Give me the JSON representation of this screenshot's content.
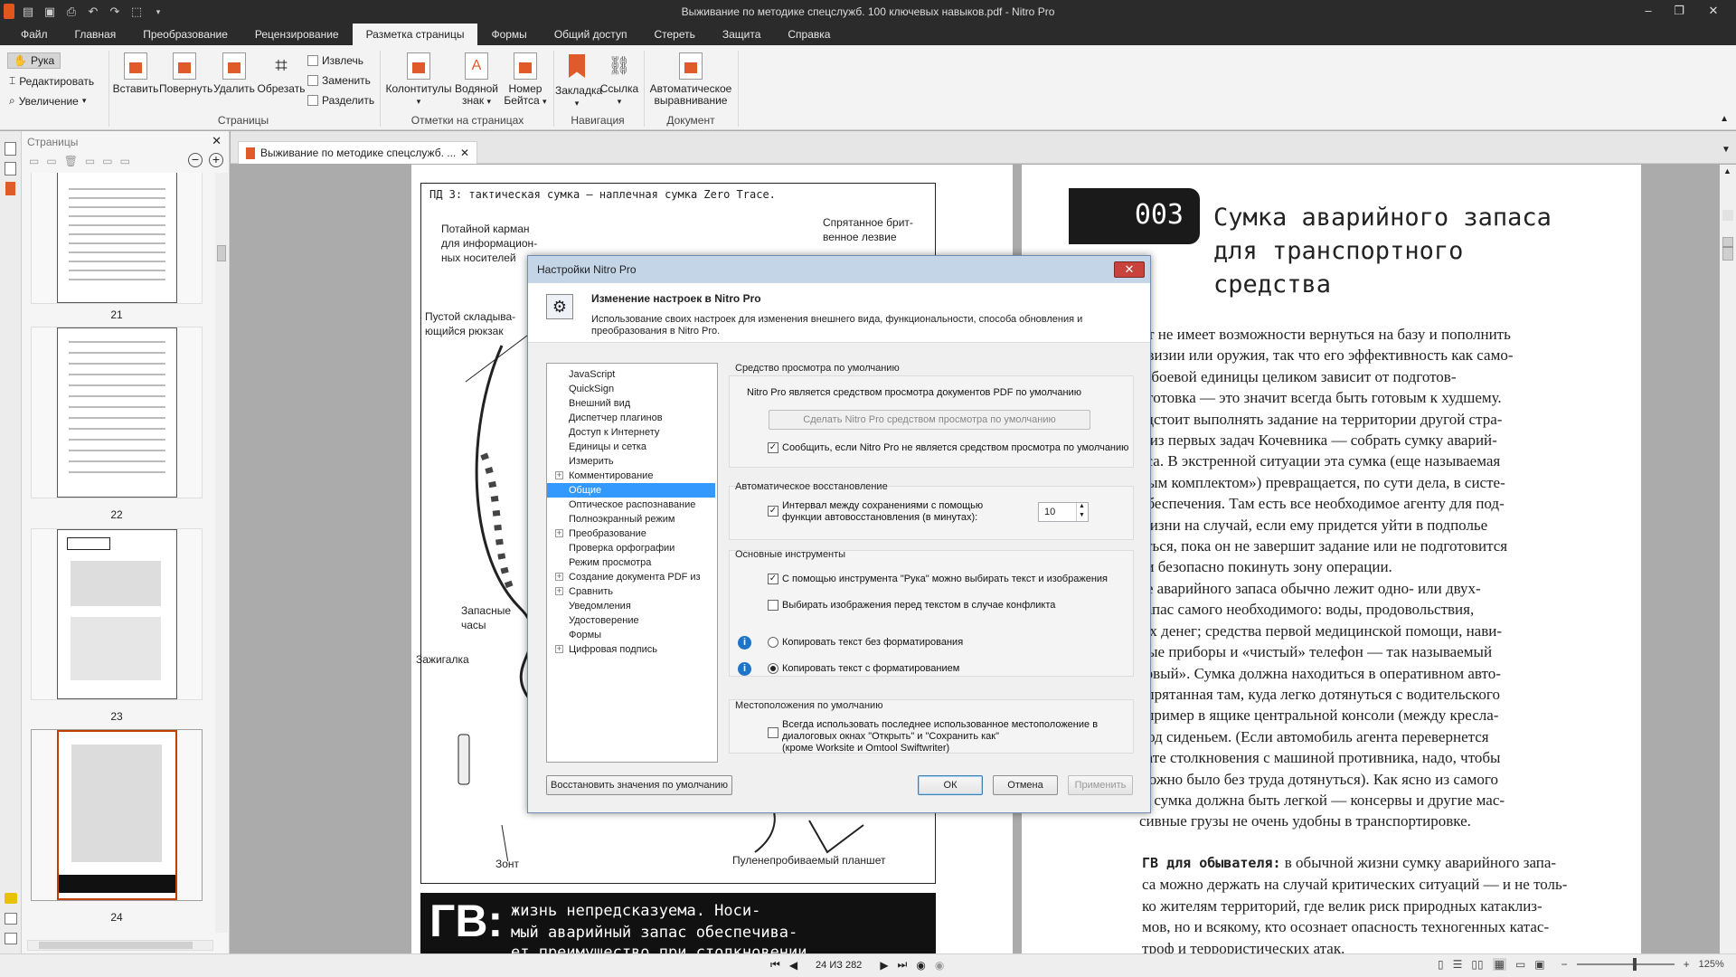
{
  "window": {
    "title": "Выживание по методике спецслужб. 100 ключевых навыков.pdf - Nitro Pro",
    "controls": [
      "–",
      "❐",
      "✕"
    ]
  },
  "menu": {
    "tabs": [
      "Файл",
      "Главная",
      "Преобразование",
      "Рецензирование",
      "Разметка страницы",
      "Формы",
      "Общий доступ",
      "Стереть",
      "Защита",
      "Справка"
    ],
    "active": "Разметка страницы"
  },
  "ribbon": {
    "tools": {
      "hand": "Рука",
      "edit": "Редактировать",
      "zoom": "Увеличение"
    },
    "pages_group": {
      "label": "Страницы",
      "insert": "Вставить",
      "rotate": "Повернуть",
      "delete": "Удалить",
      "crop": "Обрезать",
      "extract": "Извлечь",
      "replace": "Заменить",
      "split": "Разделить"
    },
    "marks_group": {
      "label": "Отметки на страницах",
      "headers": "Колонтитулы",
      "watermark1": "Водяной",
      "watermark2": "знак",
      "bates1": "Номер",
      "bates2": "Бейтса"
    },
    "nav_group": {
      "label": "Навигация",
      "bookmark": "Закладка",
      "link": "Ссылка"
    },
    "doc_group": {
      "label": "Документ",
      "autoalign1": "Автоматическое",
      "autoalign2": "выравнивание"
    }
  },
  "pages_panel": {
    "title": "Страницы",
    "thumbs": [
      "21",
      "22",
      "23",
      "24"
    ]
  },
  "document": {
    "tab_title": "Выживание по методике спецслужб. ...",
    "left_page": {
      "heading": "ПД 3: тактическая сумка — наплечная сумка Zero Trace.",
      "callouts": [
        "Потайной карман для информацион- ных носителей",
        "Спрятанное брит- венное лезвие",
        "Пустой складыва- ющийся рюкзак",
        "Запасные часы",
        "Зажигалка",
        "Зонт",
        "Пуленепробиваемый планшет"
      ],
      "banner_big": "ГВ:",
      "banner_text1": "жизнь непредсказуема. Носи-",
      "banner_text2": "мый аварийный запас обеспечива-",
      "banner_text3": "ет преимущество при столкновении"
    },
    "right_page": {
      "num": "003",
      "title1": "Сумка аварийного запаса",
      "title2": "для транспортного",
      "title3": "средства",
      "lines": [
        "нт не имеет возможности вернуться на базу и пополнить",
        "овизии или оружия, так что его эффективность как само-",
        "й боевой единицы целиком зависит от подготов-",
        "дготовка — это значит всегда быть готовым к худшему.",
        "едстоит выполнять задание на территории другой стра-",
        "а из первых задач Кочевника — собрать сумку аварий-",
        "аса. В экстренной ситуации эта сумка (еще называемая",
        "ным комплектом») превращается, по сути дела, в систе-",
        "обеспечения. Там есть все необходимое агенту для под-",
        "жизни на случай, если ему придется уйти в подполье",
        "аться, пока он не завершит задание или не подготовится",
        "ти безопасно покинуть зону операции.",
        "ке аварийного запаса обычно лежит одно- или двух-",
        "запас самого необходимого: воды, продовольствия,",
        "ых денег; средства первой медицинской помощи, нави-",
        "ные приборы и «чистый» телефон — так называемый",
        "зовый». Сумка должна находиться в оперативном авто-",
        "спрятанная там, куда легко дотянуться с водительского",
        "апример в ящике центральной консоли (между кресла-",
        "под сиденьем. (Если автомобиль агента перевернется",
        "тате столкновения с машиной противника, надо, чтобы",
        "можно было без труда дотянуться). Как ясно из самого",
        "я, сумка должна быть легкой — консервы и другие мас-",
        "сивные грузы не очень удобны в транспортировке."
      ],
      "gv_label": "ГВ для обывателя:",
      "gv_lines": [
        "в обычной жизни сумку аварийного запа-",
        "са можно держать на случай критических ситуаций — и не толь-",
        "ко жителям территорий, где велик риск природных катаклиз-",
        "мов, но и всякому, кто осознает опасность техногенных катас-",
        "троф и террористических атак."
      ]
    }
  },
  "statusbar": {
    "page_indicator": "24 ИЗ 282",
    "zoom": "125%"
  },
  "dialog": {
    "title": "Настройки Nitro Pro",
    "header_title": "Изменение настроек в Nitro Pro",
    "header_desc1": "Использование своих настроек для изменения внешнего вида, функциональности, способа обновления и",
    "header_desc2": "преобразования в Nitro Pro.",
    "tree": [
      {
        "label": "JavaScript",
        "exp": false
      },
      {
        "label": "QuickSign",
        "exp": false
      },
      {
        "label": "Внешний вид",
        "exp": false
      },
      {
        "label": "Диспетчер плагинов",
        "exp": false
      },
      {
        "label": "Доступ к Интернету",
        "exp": false
      },
      {
        "label": "Единицы и сетка",
        "exp": false
      },
      {
        "label": "Измерить",
        "exp": false
      },
      {
        "label": "Комментирование",
        "exp": true
      },
      {
        "label": "Общие",
        "exp": false,
        "selected": true
      },
      {
        "label": "Оптическое распознавание",
        "exp": false
      },
      {
        "label": "Полноэкранный режим",
        "exp": false
      },
      {
        "label": "Преобразование",
        "exp": true
      },
      {
        "label": "Проверка орфографии",
        "exp": false
      },
      {
        "label": "Режим просмотра",
        "exp": false
      },
      {
        "label": "Создание документа PDF из",
        "exp": true
      },
      {
        "label": "Сравнить",
        "exp": true
      },
      {
        "label": "Уведомления",
        "exp": false
      },
      {
        "label": "Удостоверение",
        "exp": false
      },
      {
        "label": "Формы",
        "exp": false
      },
      {
        "label": "Цифровая подпись",
        "exp": true
      }
    ],
    "viewer": {
      "heading": "Средство просмотра по умолчанию",
      "status": "Nitro Pro является средством просмотра документов PDF по умолчанию",
      "make_default": "Сделать Nitro Pro средством просмотра по умолчанию",
      "notify": "Сообщить, если Nitro Pro не является средством просмотра по умолчанию"
    },
    "autorecover": {
      "heading": "Автоматическое восстановление",
      "interval1": "Интервал между сохранениями с помощью",
      "interval2": "функции автовосстановления (в минутах):",
      "value": "10"
    },
    "tools": {
      "heading": "Основные инструменты",
      "hand_select": "С помощью инструмента \"Рука\" можно выбирать текст и изображения",
      "images_first": "Выбирать изображения перед текстом в случае конфликта",
      "copy_plain": "Копировать текст без форматирования",
      "copy_format": "Копировать текст с форматированием"
    },
    "locations": {
      "heading": "Местоположения по умолчанию",
      "line1": "Всегда использовать последнее использованное местоположение в",
      "line2": "диалоговых окнах \"Открыть\" и \"Сохранить как\"",
      "line3": "(кроме Worksite и Omtool Swiftwriter)"
    },
    "buttons": {
      "restore": "Восстановить значения по умолчанию",
      "ok": "ОК",
      "cancel": "Отмена",
      "apply": "Применить"
    }
  }
}
